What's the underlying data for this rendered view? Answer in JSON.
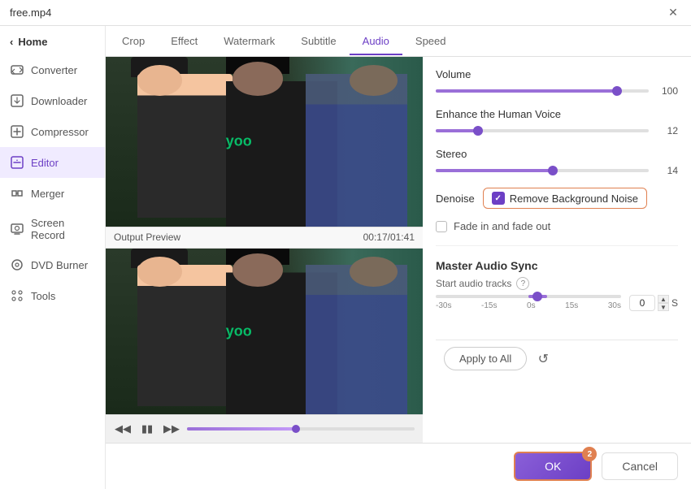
{
  "titleBar": {
    "filename": "free.mp4",
    "closeLabel": "✕"
  },
  "sidebar": {
    "backLabel": "Home",
    "items": [
      {
        "id": "converter",
        "label": "Converter",
        "icon": "converter-icon"
      },
      {
        "id": "downloader",
        "label": "Downloader",
        "icon": "downloader-icon"
      },
      {
        "id": "compressor",
        "label": "Compressor",
        "icon": "compressor-icon"
      },
      {
        "id": "editor",
        "label": "Editor",
        "icon": "editor-icon",
        "active": true
      },
      {
        "id": "merger",
        "label": "Merger",
        "icon": "merger-icon"
      },
      {
        "id": "screen-record",
        "label": "Screen Record",
        "icon": "screen-record-icon"
      },
      {
        "id": "dvd-burner",
        "label": "DVD Burner",
        "icon": "dvd-burner-icon"
      },
      {
        "id": "tools",
        "label": "Tools",
        "icon": "tools-icon"
      }
    ]
  },
  "tabs": [
    {
      "id": "crop",
      "label": "Crop"
    },
    {
      "id": "effect",
      "label": "Effect"
    },
    {
      "id": "watermark",
      "label": "Watermark"
    },
    {
      "id": "subtitle",
      "label": "Subtitle"
    },
    {
      "id": "audio",
      "label": "Audio",
      "active": true
    },
    {
      "id": "speed",
      "label": "Speed"
    }
  ],
  "videoPanel": {
    "outputPreviewLabel": "Output Preview",
    "timestamp": "00:17/01:41"
  },
  "controls": {
    "volumeLabel": "Volume",
    "volumeValue": "100",
    "volumePercent": 85,
    "enhanceLabel": "Enhance the Human Voice",
    "enhanceValue": "12",
    "enhancePercent": 20,
    "stereoLabel": "Stereo",
    "stereoValue": "14",
    "stereoPercent": 55,
    "denoiseLabel": "Denoise",
    "removeBgNoiseLabel": "Remove Background Noise",
    "fadeLabel": "Fade in and fade out",
    "masterAudioTitle": "Master Audio Sync",
    "masterAudioSubtitle": "Start audio tracks",
    "syncLabels": [
      "-30s",
      "-15s",
      "0s",
      "15s",
      "30s"
    ],
    "syncValue": "0",
    "syncUnit": "S",
    "applyToAllLabel": "Apply to All",
    "refreshLabel": "↺"
  },
  "footer": {
    "okLabel": "OK",
    "okBadge": "2",
    "cancelLabel": "Cancel"
  }
}
